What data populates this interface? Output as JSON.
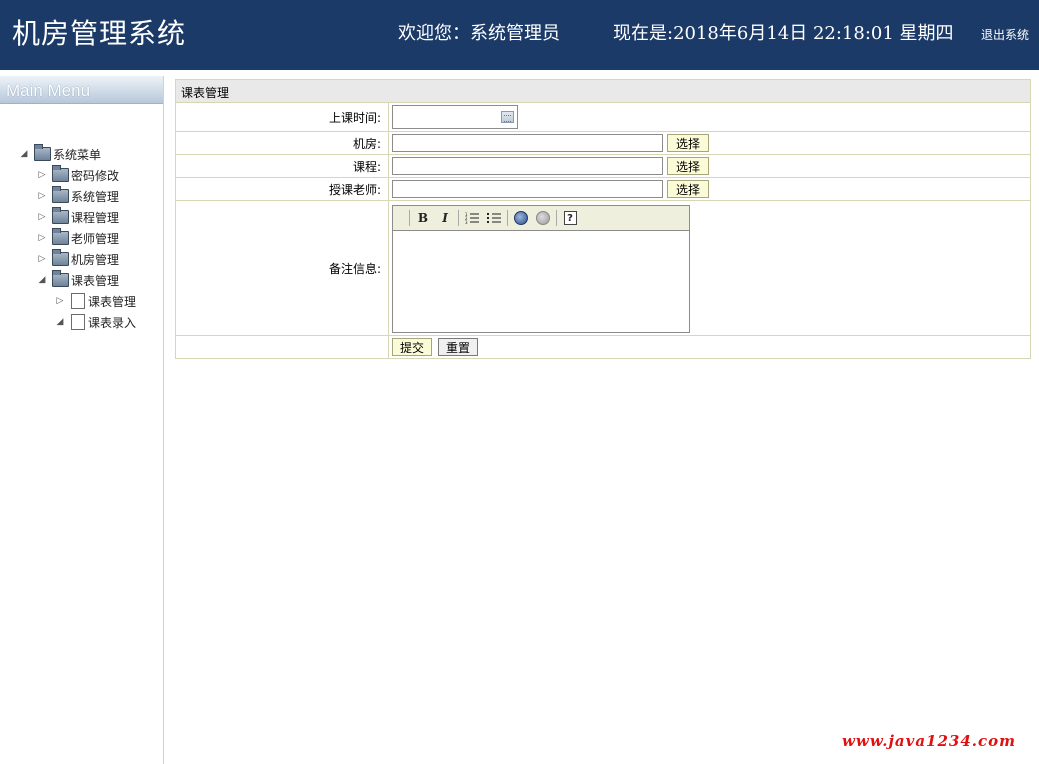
{
  "header": {
    "app_title": "机房管理系统",
    "welcome": "欢迎您：系统管理员",
    "now": "现在是:2018年6月14日 22:18:01 星期四",
    "logout": "退出系统"
  },
  "sidebar": {
    "menu_title": "Main Menu",
    "tree": [
      {
        "label": "系统菜单",
        "type": "folder",
        "expanded": true,
        "depth": 0
      },
      {
        "label": "密码修改",
        "type": "folder",
        "expanded": false,
        "depth": 1
      },
      {
        "label": "系统管理",
        "type": "folder",
        "expanded": false,
        "depth": 1
      },
      {
        "label": "课程管理",
        "type": "folder",
        "expanded": false,
        "depth": 1
      },
      {
        "label": "老师管理",
        "type": "folder",
        "expanded": false,
        "depth": 1
      },
      {
        "label": "机房管理",
        "type": "folder",
        "expanded": false,
        "depth": 1
      },
      {
        "label": "课表管理",
        "type": "folder",
        "expanded": true,
        "depth": 1
      },
      {
        "label": "课表管理",
        "type": "page",
        "expanded": false,
        "depth": 2
      },
      {
        "label": "课表录入",
        "type": "page",
        "expanded": true,
        "depth": 2
      }
    ]
  },
  "form": {
    "panel_title": "课表管理",
    "time_label": "上课时间:",
    "room_label": "机房:",
    "course_label": "课程:",
    "teacher_label": "授课老师:",
    "note_label": "备注信息:",
    "time_value": "",
    "room_value": "",
    "course_value": "",
    "teacher_value": "",
    "note_value": "",
    "pick_label": "选择",
    "submit_label": "提交",
    "reset_label": "重置"
  },
  "editor_toolbar": {
    "bold": "B",
    "italic": "I",
    "help": "?"
  },
  "watermark": "www.java1234.com"
}
